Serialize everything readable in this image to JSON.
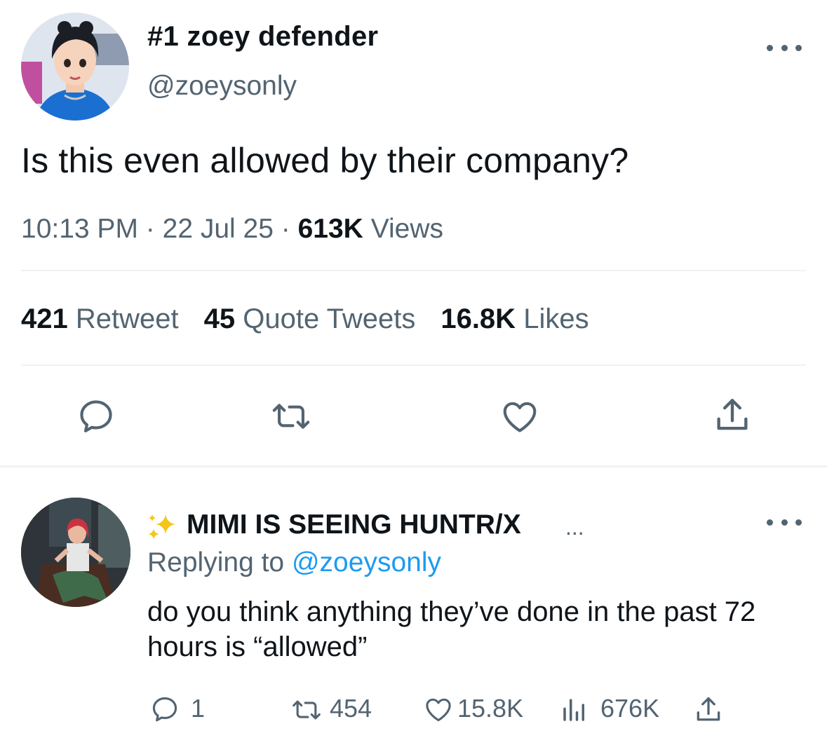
{
  "main_tweet": {
    "display_name": "#1 zoey defender",
    "handle": "@zoeysonly",
    "text": "Is this even allowed by their company?",
    "time": "10:13 PM",
    "date": "22 Jul 25",
    "views_count": "613K",
    "views_label": "Views",
    "separator": "·",
    "retweets_count": "421",
    "retweets_label": "Retweet",
    "quotes_count": "45",
    "quotes_label": "Quote Tweets",
    "likes_count": "16.8K",
    "likes_label": "Likes"
  },
  "reply_tweet": {
    "display_name": "MIMI IS SEEING HUNTR/X",
    "name_ellipsis": "...",
    "replying_prefix": "Replying to",
    "replying_handle": "@zoeysonly",
    "text": "do you think anything they’ve done in the past 72 hours is “allowed”",
    "reply_count": "1",
    "retweet_count": "454",
    "like_count": "15.8K",
    "views_count": "676K"
  },
  "colors": {
    "text_primary": "#0f1419",
    "text_secondary": "#536471",
    "link": "#1d9bf0",
    "divider": "#eff3f4",
    "sparkle": "#f5c518"
  },
  "icons": [
    "avatar",
    "more-icon",
    "reply-icon",
    "retweet-icon",
    "like-icon",
    "share-icon",
    "views-icon",
    "sparkles-emoji"
  ]
}
